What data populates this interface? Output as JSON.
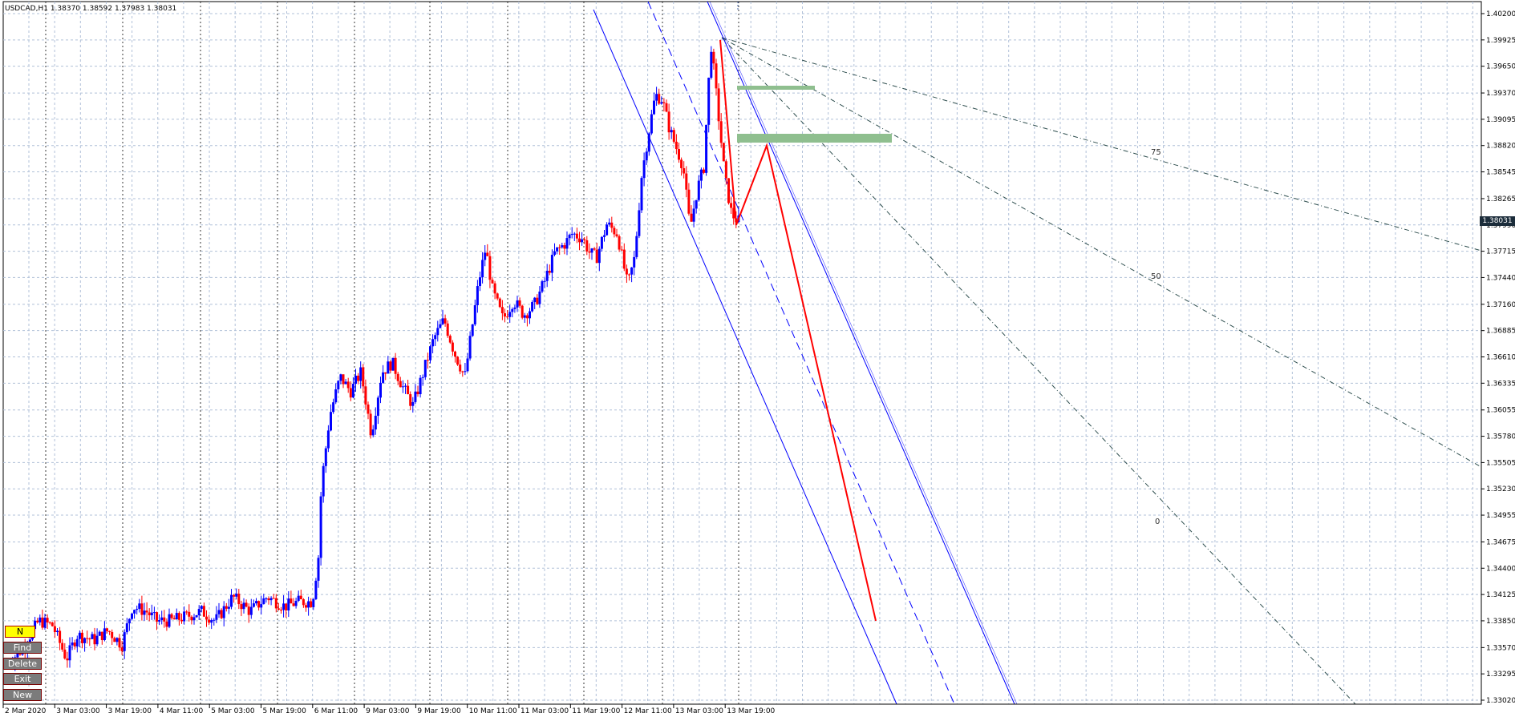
{
  "header": {
    "symbol_info": "USDCAD,H1  1.38370 1.38592 1.37983 1.38031"
  },
  "current_price": "1.38031",
  "colors": {
    "bull": "#0000ff",
    "bear": "#ff0000",
    "grid": "#b0c0d8",
    "zone": "#8fbf8f",
    "label_bg": "#1b2c3a"
  },
  "price_axis": {
    "labels": [
      "1.40200",
      "1.39925",
      "1.39650",
      "1.39370",
      "1.39095",
      "1.38820",
      "1.38545",
      "1.38265",
      "1.37990",
      "1.37715",
      "1.37440",
      "1.37160",
      "1.36885",
      "1.36610",
      "1.36335",
      "1.36055",
      "1.35780",
      "1.35505",
      "1.35230",
      "1.34955",
      "1.34675",
      "1.34400",
      "1.34125",
      "1.33850",
      "1.33570",
      "1.33295",
      "1.33020"
    ]
  },
  "time_axis": {
    "labels": [
      "2 Mar 2020",
      "3 Mar 03:00",
      "3 Mar 19:00",
      "4 Mar 11:00",
      "5 Mar 03:00",
      "5 Mar 19:00",
      "6 Mar 11:00",
      "9 Mar 03:00",
      "9 Mar 19:00",
      "10 Mar 11:00",
      "11 Mar 03:00",
      "11 Mar 19:00",
      "12 Mar 11:00",
      "13 Mar 03:00",
      "13 Mar 19:00"
    ]
  },
  "fib_labels": [
    "75",
    "50",
    "0"
  ],
  "buttons": {
    "n": "N",
    "find": "Find",
    "delete": "Delete",
    "exit": "Exit",
    "new": "New"
  },
  "chart_data": {
    "type": "candlestick",
    "symbol": "USDCAD",
    "timeframe": "H1",
    "ohlc_last": {
      "open": 1.3837,
      "high": 1.38592,
      "low": 1.37983,
      "close": 1.38031
    },
    "ylim": [
      1.3302,
      1.402
    ],
    "y_ticks": [
      1.402,
      1.39925,
      1.3965,
      1.3937,
      1.39095,
      1.3882,
      1.38545,
      1.38265,
      1.3799,
      1.37715,
      1.3744,
      1.3716,
      1.36885,
      1.3661,
      1.36335,
      1.36055,
      1.3578,
      1.35505,
      1.3523,
      1.34955,
      1.34675,
      1.344,
      1.34125,
      1.3385,
      1.3357,
      1.33295,
      1.3302
    ],
    "x_ticks": [
      "2 Mar 2020",
      "3 Mar 03:00",
      "3 Mar 19:00",
      "4 Mar 11:00",
      "5 Mar 03:00",
      "5 Mar 19:00",
      "6 Mar 11:00",
      "9 Mar 03:00",
      "9 Mar 19:00",
      "10 Mar 11:00",
      "11 Mar 03:00",
      "11 Mar 19:00",
      "12 Mar 11:00",
      "13 Mar 03:00",
      "13 Mar 19:00"
    ],
    "grid": true,
    "trend_segments": [
      {
        "name": "price-path",
        "points": [
          [
            1.39925,
            0
          ],
          [
            1.3799,
            1
          ],
          [
            1.3882,
            2
          ],
          [
            1.3385,
            3
          ]
        ]
      }
    ],
    "candle_path": [
      [
        0,
        1.334
      ],
      [
        8,
        1.3355
      ],
      [
        18,
        1.3385
      ],
      [
        26,
        1.338
      ],
      [
        34,
        1.3345
      ],
      [
        40,
        1.337
      ],
      [
        50,
        1.3365
      ],
      [
        58,
        1.3375
      ],
      [
        66,
        1.336
      ],
      [
        72,
        1.34
      ],
      [
        80,
        1.3395
      ],
      [
        86,
        1.3385
      ],
      [
        94,
        1.3385
      ],
      [
        104,
        1.339
      ],
      [
        112,
        1.3395
      ],
      [
        120,
        1.3385
      ],
      [
        130,
        1.341
      ],
      [
        140,
        1.3395
      ],
      [
        150,
        1.341
      ],
      [
        160,
        1.34
      ],
      [
        168,
        1.3405
      ],
      [
        176,
        1.3405
      ],
      [
        180,
        1.346
      ],
      [
        181,
        1.3525
      ],
      [
        186,
        1.36
      ],
      [
        192,
        1.364
      ],
      [
        198,
        1.3625
      ],
      [
        204,
        1.3645
      ],
      [
        210,
        1.358
      ],
      [
        216,
        1.3645
      ],
      [
        222,
        1.3655
      ],
      [
        228,
        1.363
      ],
      [
        234,
        1.361
      ],
      [
        240,
        1.3645
      ],
      [
        246,
        1.368
      ],
      [
        252,
        1.37
      ],
      [
        258,
        1.3665
      ],
      [
        264,
        1.364
      ],
      [
        272,
        1.374
      ],
      [
        276,
        1.3775
      ],
      [
        280,
        1.373
      ],
      [
        286,
        1.37
      ],
      [
        292,
        1.372
      ],
      [
        298,
        1.3705
      ],
      [
        304,
        1.3715
      ],
      [
        310,
        1.374
      ],
      [
        316,
        1.377
      ],
      [
        322,
        1.378
      ],
      [
        326,
        1.379
      ],
      [
        332,
        1.3785
      ],
      [
        336,
        1.377
      ],
      [
        340,
        1.3765
      ],
      [
        346,
        1.38
      ],
      [
        352,
        1.379
      ],
      [
        358,
        1.3735
      ],
      [
        362,
        1.3765
      ],
      [
        366,
        1.385
      ],
      [
        370,
        1.3895
      ],
      [
        374,
        1.3935
      ],
      [
        378,
        1.393
      ],
      [
        382,
        1.39
      ],
      [
        386,
        1.388
      ],
      [
        390,
        1.386
      ],
      [
        394,
        1.3795
      ],
      [
        398,
        1.3835
      ],
      [
        402,
        1.386
      ],
      [
        406,
        1.399
      ],
      [
        410,
        1.392
      ],
      [
        414,
        1.385
      ],
      [
        418,
        1.381
      ],
      [
        422,
        1.3803
      ]
    ]
  }
}
